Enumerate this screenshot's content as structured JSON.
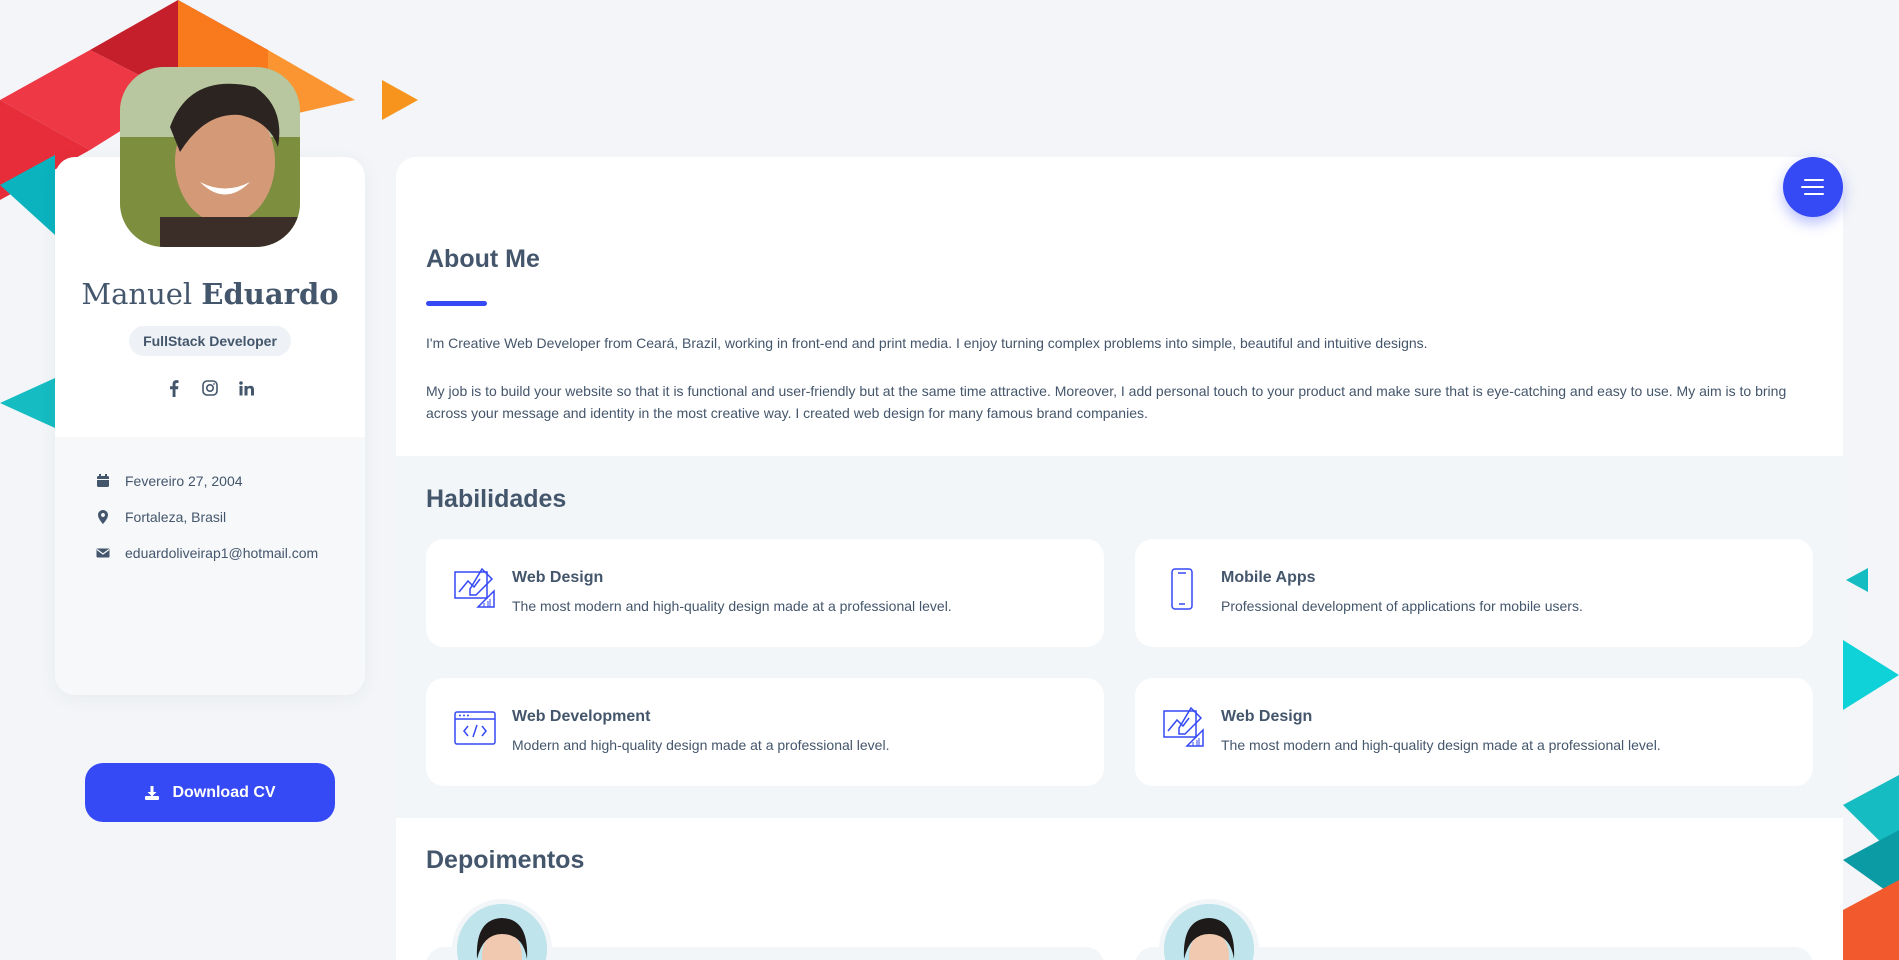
{
  "profile": {
    "first_name": "Manuel",
    "last_name": "Eduardo",
    "role": "FullStack Developer",
    "socials": [
      "facebook-icon",
      "instagram-icon",
      "linkedin-icon"
    ],
    "birthday": "Fevereiro 27, 2004",
    "location": "Fortaleza, Brasil",
    "email": "eduardoliveirap1@hotmail.com",
    "download_label": "Download CV"
  },
  "about": {
    "title": "About Me",
    "paragraph1": "I'm Creative Web Developer from Ceará, Brazil, working in front-end and print media. I enjoy turning complex problems into simple, beautiful and intuitive designs.",
    "paragraph2": "My job is to build your website so that it is functional and user-friendly but at the same time attractive. Moreover, I add personal touch to your product and make sure that is eye-catching and easy to use. My aim is to bring across your message and identity in the most creative way. I created web design for many famous brand companies."
  },
  "skills": {
    "title": "Habilidades",
    "items": [
      {
        "title": "Web Design",
        "desc": "The most modern and high-quality design made at a professional level.",
        "icon": "design-icon"
      },
      {
        "title": "Mobile Apps",
        "desc": "Professional development of applications for mobile users.",
        "icon": "mobile-icon"
      },
      {
        "title": "Web Development",
        "desc": "Modern and high-quality design made at a professional level.",
        "icon": "code-icon"
      },
      {
        "title": "Web Design",
        "desc": "The most modern and high-quality design made at a professional level.",
        "icon": "design-icon"
      }
    ]
  },
  "testimonials": {
    "title": "Depoimentos"
  },
  "colors": {
    "accent": "#3549f5",
    "text": "#44566c",
    "background": "#f3f5f8"
  }
}
